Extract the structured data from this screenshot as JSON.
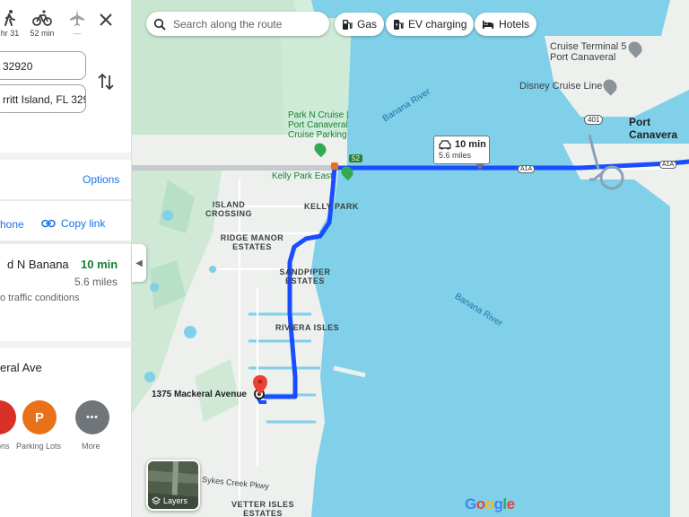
{
  "modes": [
    {
      "icon": "walk-icon",
      "label": "hr 31"
    },
    {
      "icon": "bike-icon",
      "label": "52 min"
    },
    {
      "icon": "airplane-icon",
      "label": "—"
    }
  ],
  "inputs": {
    "origin": "32920",
    "destination": "rritt Island, FL 329"
  },
  "options_label": "Options",
  "share": {
    "phone_text": "hone",
    "copy_link": "Copy link"
  },
  "route": {
    "name": "d N Banana",
    "time": "10 min",
    "distance": "5.6 miles",
    "traffic": "o traffic conditions"
  },
  "destination_title": "eral Ave",
  "nearby": [
    {
      "label": "ons",
      "color": "#d93025",
      "glyph": ""
    },
    {
      "label": "Parking Lots",
      "color": "#e8711a",
      "glyph": "P"
    },
    {
      "label": "More",
      "color": "#70757a",
      "glyph": "•••"
    }
  ],
  "search": {
    "placeholder": "Search along the route"
  },
  "chips": [
    {
      "label": "Gas",
      "icon": "gas-pump-icon"
    },
    {
      "label": "EV charging",
      "icon": "ev-charging-icon"
    },
    {
      "label": "Hotels",
      "icon": "bed-icon"
    }
  ],
  "callout": {
    "time": "10 min",
    "distance": "5.6 miles"
  },
  "map_labels": {
    "cruise_terminal": "Cruise Terminal 5 - Port Canaveral",
    "disney_cruise": "Disney Cruise Line",
    "port_canaveral": "Port Canavera",
    "park_n_cruise": "Park N Cruise | Port Canaveral Cruise Parking",
    "kelly_park_east": "Kelly Park East",
    "kelly_park": "KELLY PARK",
    "island_crossing": "ISLAND CROSSING",
    "ridge_manor": "RIDGE MANOR ESTATES",
    "sandpiper": "SANDPIPER ESTATES",
    "riviera_isles": "RIVIERA ISLES",
    "banana_river_1": "Banana River",
    "banana_river_2": "Banana River",
    "mackerel": "1375 Mackeral Avenue",
    "sykes_creek": "Sykes Creek Pkwy",
    "vetter_isles": "VETTER ISLES ESTATES",
    "shield_401": "401",
    "shield_52": "52",
    "a1a_1": "A1A",
    "a1a_2": "A1A"
  },
  "layers_label": "Layers",
  "colors": {
    "water": "#7fd0e8",
    "land": "#eef0ee",
    "green": "#cdebd6",
    "route": "#1a4dff"
  }
}
